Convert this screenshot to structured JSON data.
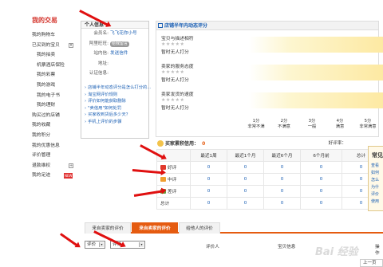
{
  "sidebar": {
    "title": "我的交易",
    "items": [
      {
        "label": "我的购物车",
        "sub": false,
        "box": ""
      },
      {
        "label": "已买到的宝贝",
        "sub": false,
        "box": "▾"
      },
      {
        "label": "我的拍卖",
        "sub": true,
        "box": ""
      },
      {
        "label": "机票酒店保险",
        "sub": true,
        "box": ""
      },
      {
        "label": "我的彩票",
        "sub": true,
        "box": ""
      },
      {
        "label": "我的游戏",
        "sub": true,
        "box": ""
      },
      {
        "label": "我的电子书",
        "sub": true,
        "box": ""
      },
      {
        "label": "我的理财",
        "sub": true,
        "box": ""
      },
      {
        "label": "购买过的店铺",
        "sub": false,
        "box": ""
      },
      {
        "label": "我的收藏",
        "sub": false,
        "box": ""
      },
      {
        "label": "我的积分",
        "sub": false,
        "box": ""
      },
      {
        "label": "我的优惠信息",
        "sub": false,
        "box": ""
      },
      {
        "label": "评价管理",
        "sub": false,
        "box": ""
      },
      {
        "label": "退款维权",
        "sub": false,
        "box": "+"
      },
      {
        "label": "我的足迹",
        "sub": false,
        "box": "NEW"
      }
    ]
  },
  "personal_info": {
    "title": "个人信息",
    "rows": [
      {
        "key": "会员名:",
        "value": "飞飞花你小号",
        "pill": ""
      },
      {
        "key": "阿里旺旺:",
        "value": "",
        "pill": "给我留言"
      },
      {
        "key": "站内信:",
        "value": "发送信件",
        "pill": ""
      },
      {
        "key": "地址:",
        "value": "",
        "pill": ""
      },
      {
        "key": "认证信息:",
        "value": "",
        "pill": ""
      }
    ],
    "links": [
      "店铺半年动态评分是怎么打分的...",
      "淘宝网评价规则",
      "评价如何能获取删除",
      "\"卖信用\"如何处罚",
      "买家收到货后多少天？",
      "手机上评价的步骤"
    ]
  },
  "store_rating": {
    "title": "店铺半年内动态评分",
    "rows": [
      {
        "label": "宝贝与描述相符",
        "stars": "★★★★★",
        "status": "暂时无人打分"
      },
      {
        "label": "卖家的服务态度",
        "stars": "★★★★★",
        "status": "暂时无人打分"
      },
      {
        "label": "卖家发货的速度",
        "stars": "★★★★★",
        "status": "暂时无人打分"
      }
    ],
    "scale": [
      {
        "score": "1分",
        "text": "非常不满"
      },
      {
        "score": "2分",
        "text": "不满意"
      },
      {
        "score": "3分",
        "text": "一般"
      },
      {
        "score": "4分",
        "text": "满意"
      },
      {
        "score": "5分",
        "text": "非常满意"
      }
    ]
  },
  "buyer_credit": {
    "title": "买家累积信用：",
    "value": "0",
    "rate_label": "好评率：",
    "columns": [
      "",
      "最近1周",
      "最近1个月",
      "最近6个月",
      "6个月前",
      "总计"
    ],
    "rows": [
      {
        "label": "好评",
        "color": "#e0382c",
        "values": [
          "0",
          "0",
          "0",
          "0",
          "0"
        ]
      },
      {
        "label": "中评",
        "color": "#f0a030",
        "values": [
          "0",
          "0",
          "0",
          "0",
          "0"
        ]
      },
      {
        "label": "差评",
        "color": "#6a9a3a",
        "values": [
          "0",
          "0",
          "0",
          "0",
          "0"
        ]
      },
      {
        "label": "总计",
        "color": "",
        "values": [
          "0",
          "0",
          "0",
          "0",
          "0"
        ]
      }
    ]
  },
  "help": {
    "title": "常见",
    "items": [
      "查看",
      "如何",
      "怎么",
      "为什",
      "评价",
      "使用"
    ]
  },
  "tabs": [
    {
      "label": "来自卖家的评价",
      "active": false
    },
    {
      "label": "来自卖家的评价",
      "active": true
    },
    {
      "label": "给他人的评价",
      "active": false
    }
  ],
  "filters": {
    "select1": "评价",
    "select2": "评论",
    "col_rater": "评价人",
    "col_info": "宝贝信息",
    "col_op": "操作"
  },
  "pager": "上一页",
  "watermark": "Bai 经验"
}
